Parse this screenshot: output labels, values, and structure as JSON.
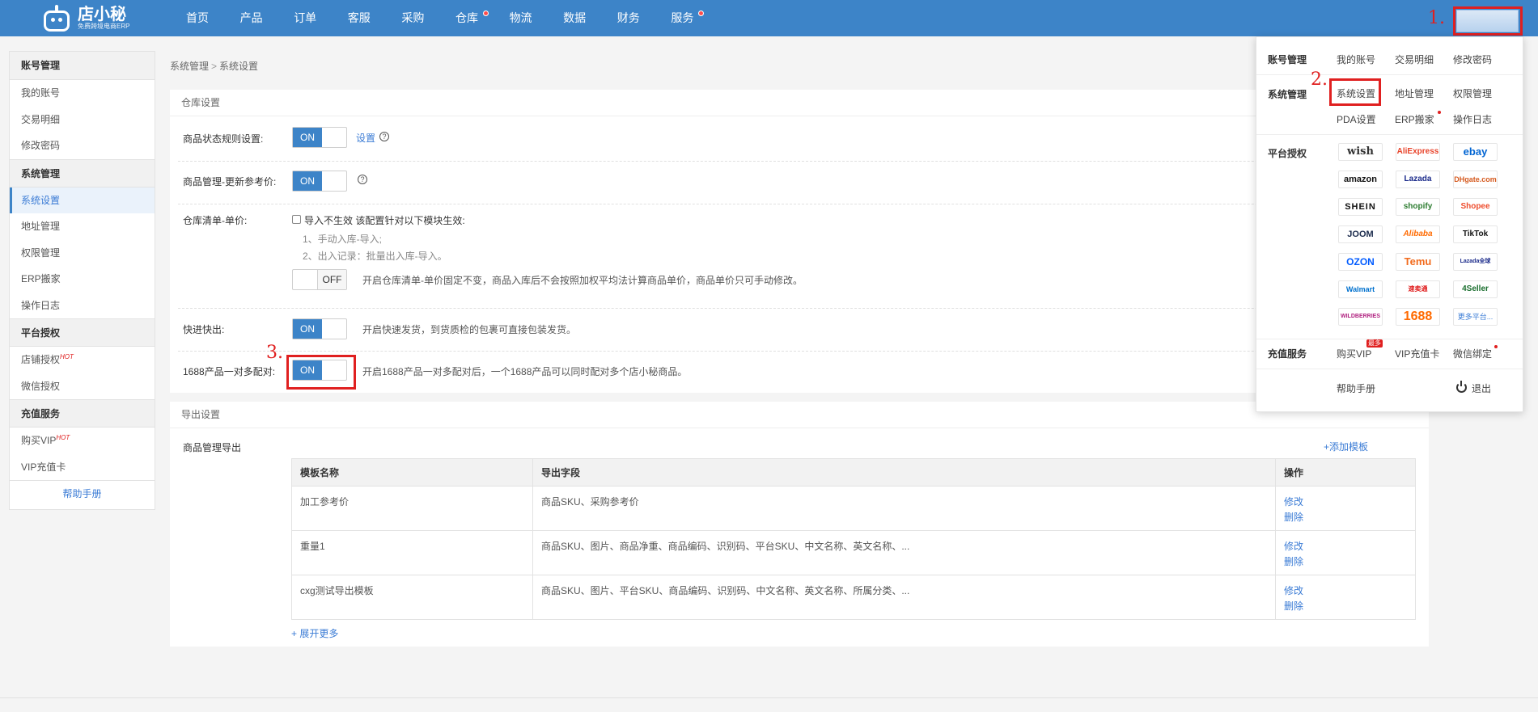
{
  "logo": {
    "name": "店小秘",
    "tagline": "免费跨境电商ERP"
  },
  "nav": [
    "首页",
    "产品",
    "订单",
    "客服",
    "采购",
    "仓库",
    "物流",
    "数据",
    "财务",
    "服务"
  ],
  "annotations": {
    "step1": "1.",
    "step2": "2.",
    "step3": "3."
  },
  "sidebar": {
    "groups": [
      {
        "title": "账号管理",
        "items": [
          "我的账号",
          "交易明细",
          "修改密码"
        ]
      },
      {
        "title": "系统管理",
        "items": [
          "系统设置",
          "地址管理",
          "权限管理",
          "ERP搬家",
          "操作日志"
        ]
      },
      {
        "title": "平台授权",
        "items": [
          "店铺授权",
          "微信授权"
        ]
      },
      {
        "title": "充值服务",
        "items": [
          "购买VIP",
          "VIP充值卡"
        ]
      }
    ],
    "hot": "HOT",
    "help": "帮助手册"
  },
  "breadcrumb": {
    "parent": "系统管理",
    "sep": ">",
    "current": "系统设置"
  },
  "warehouse": {
    "title": "仓库设置",
    "row1": {
      "label": "商品状态规则设置:",
      "switch": "ON",
      "link": "设置",
      "help": "?"
    },
    "row2": {
      "label": "商品管理-更新参考价:",
      "switch": "ON",
      "help": "?"
    },
    "row3": {
      "label": "仓库清单-单价:",
      "checkbox_text": "导入不生效 该配置针对以下模块生效:",
      "note1": "1、手动入库-导入;",
      "note2": "2、出入记录：批量出入库-导入。",
      "switch": "OFF",
      "desc": "开启仓库清单-单价固定不变，商品入库后不会按照加权平均法计算商品单价，商品单价只可手动修改。"
    },
    "row4": {
      "label": "快进快出:",
      "switch": "ON",
      "desc": "开启快速发货，到货质检的包裹可直接包装发货。"
    },
    "row5": {
      "label": "1688产品一对多配对:",
      "switch": "ON",
      "desc": "开启1688产品一对多配对后，一个1688产品可以同时配对多个店小秘商品。"
    }
  },
  "export": {
    "title": "导出设置",
    "label": "商品管理导出",
    "add_template": "+添加模板",
    "columns": [
      "模板名称",
      "导出字段",
      "操作"
    ],
    "rows": [
      {
        "name": "加工参考价",
        "fields": "商品SKU、采购参考价",
        "edit": "修改",
        "delete": "删除"
      },
      {
        "name": "重量1",
        "fields": "商品SKU、图片、商品净重、商品编码、识别码、平台SKU、中文名称、英文名称、...",
        "edit": "修改",
        "delete": "删除"
      },
      {
        "name": "cxg测试导出模板",
        "fields": "商品SKU、图片、平台SKU、商品编码、识别码、中文名称、英文名称、所属分类、...",
        "edit": "修改",
        "delete": "删除"
      }
    ],
    "expand_more": "+ 展开更多"
  },
  "dropdown": {
    "account": {
      "label": "账号管理",
      "items": [
        "我的账号",
        "交易明细",
        "修改密码"
      ]
    },
    "system": {
      "label": "系统管理",
      "items": [
        "系统设置",
        "地址管理",
        "权限管理",
        "PDA设置",
        "ERP搬家",
        "操作日志"
      ]
    },
    "platforms": {
      "label": "平台授权",
      "items": [
        "wish",
        "AliExpress",
        "ebay",
        "amazon",
        "Lazada",
        "DHgate.com",
        "SHEIN",
        "shopify",
        "Shopee",
        "JOOM",
        "Alibaba",
        "TikTok",
        "OZON",
        "Temu",
        "Lazada全球",
        "Walmart",
        "速卖通",
        "4Seller",
        "WILDBERRIES",
        "1688",
        "更多平台..."
      ]
    },
    "recharge": {
      "label": "充值服务",
      "items": [
        "购买VIP",
        "VIP充值卡",
        "微信绑定"
      ],
      "badge": "最多"
    },
    "help": "帮助手册",
    "logout": "退出"
  }
}
